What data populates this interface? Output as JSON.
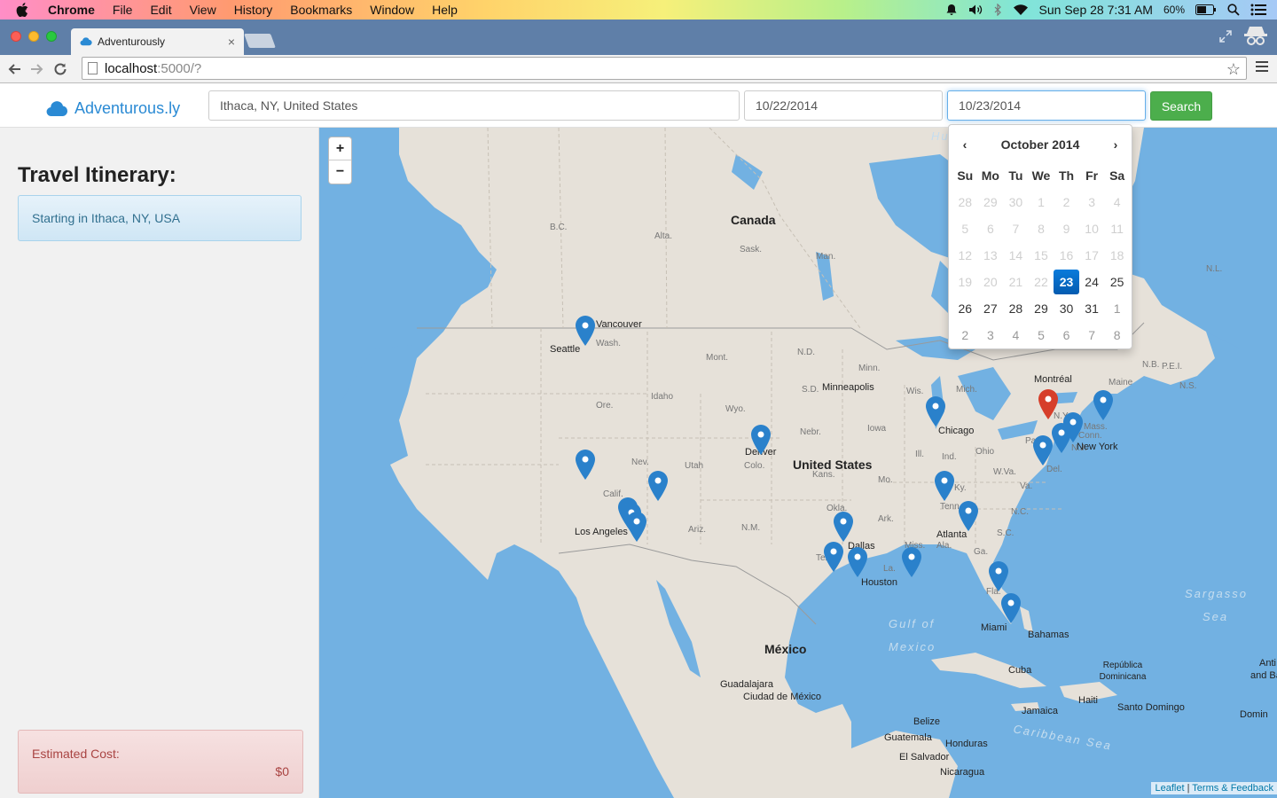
{
  "menubar": {
    "app_name": "Chrome",
    "items": [
      "File",
      "Edit",
      "View",
      "History",
      "Bookmarks",
      "Window",
      "Help"
    ],
    "clock": "Sun Sep 28  7:31 AM",
    "battery": "60%"
  },
  "browser": {
    "tab_title": "Adventurously",
    "url_host": "localhost",
    "url_path": ":5000/?"
  },
  "navbar": {
    "brand": "Adventurous.ly",
    "location_value": "Ithaca, NY, United States",
    "start_date_value": "10/22/2014",
    "end_date_value": "10/23/2014",
    "search_label": "Search"
  },
  "sidebar": {
    "title": "Travel Itinerary:",
    "items": [
      {
        "label": "Starting in Ithaca, NY, USA"
      }
    ],
    "cost_label": "Estimated Cost:",
    "cost_value": "$0"
  },
  "map": {
    "zoom_in": "+",
    "zoom_out": "−",
    "attribution_leaflet": "Leaflet",
    "attribution_sep": " | ",
    "attribution_terms": "Terms & Feedback",
    "labels": {
      "canada": "Canada",
      "united_states": "United States",
      "mexico": "México",
      "bc": "B.C.",
      "alta": "Alta.",
      "sask": "Sask.",
      "man": "Man.",
      "nl": "N.L.",
      "nb": "N.B.",
      "pei": "P.E.I.",
      "ns": "N.S.",
      "maine": "Maine",
      "hu": "Hu",
      "wash": "Wash.",
      "ore": "Ore.",
      "idaho": "Idaho",
      "mont": "Mont.",
      "wyo": "Wyo.",
      "nd": "N.D.",
      "sd": "S.D.",
      "nebr": "Nebr.",
      "minn": "Minn.",
      "iowa": "Iowa",
      "wis": "Wis.",
      "mich": "Mich.",
      "ill": "Ill.",
      "ind": "Ind.",
      "ohio": "Ohio",
      "wva": "W.Va.",
      "va": "Va.",
      "ky": "Ky.",
      "tenn": "Tenn.",
      "nc": "N.C.",
      "sc": "S.C.",
      "ga": "Ga.",
      "ala": "Ala.",
      "miss": "Miss.",
      "la": "La.",
      "ark": "Ark.",
      "mo": "Mo.",
      "kans": "Kans.",
      "okla": "Okla.",
      "tex": "Tex.",
      "nm": "N.M.",
      "ariz": "Ariz.",
      "utah": "Utah",
      "nev": "Nev.",
      "calif": "Calif.",
      "colo": "Colo.",
      "fla": "Fla.",
      "mass": "Mass.",
      "conn": "Conn.",
      "nj": "N.J.",
      "pa": "Pa.",
      "del": "Del.",
      "ny": "N.Y.",
      "seattle": "Seattle",
      "vancouver": "Vancouver",
      "los_angeles": "Los Angeles",
      "denver": "Denver",
      "minneapolis": "Minneapolis",
      "chicago": "Chicago",
      "dallas": "Dallas",
      "houston": "Houston",
      "atlanta": "Atlanta",
      "miami": "Miami",
      "new_york": "New York",
      "montreal": "Montréal",
      "bahamas": "Bahamas",
      "cuba": "Cuba",
      "haiti": "Haiti",
      "jamaica": "Jamaica",
      "republica_dominicana": "República Dominicana",
      "santo_domingo": "Santo Domingo",
      "guadalajara": "Guadalajara",
      "ciudad_de_mexico": "Ciudad de México",
      "belize": "Belize",
      "guatemala": "Guatemala",
      "honduras": "Honduras",
      "el_salvador": "El Salvador",
      "nicaragua": "Nicaragua",
      "gulf_of_mexico_1": "Gulf of",
      "gulf_of_mexico_2": "Mexico",
      "sargasso_1": "Sargasso",
      "sargasso_2": "Sea",
      "caribbean": "Caribbean Sea",
      "antigua": "Anti",
      "and_ba": "and Ba",
      "domin": "Domin"
    }
  },
  "datepicker": {
    "month_title": "October 2014",
    "prev": "‹",
    "next": "›",
    "weekdays": [
      "Su",
      "Mo",
      "Tu",
      "We",
      "Th",
      "Fr",
      "Sa"
    ],
    "weeks": [
      [
        "28",
        "29",
        "30",
        "1",
        "2",
        "3",
        "4"
      ],
      [
        "5",
        "6",
        "7",
        "8",
        "9",
        "10",
        "11"
      ],
      [
        "12",
        "13",
        "14",
        "15",
        "16",
        "17",
        "18"
      ],
      [
        "19",
        "20",
        "21",
        "22",
        "23",
        "24",
        "25"
      ],
      [
        "26",
        "27",
        "28",
        "29",
        "30",
        "31",
        "1"
      ],
      [
        "2",
        "3",
        "4",
        "5",
        "6",
        "7",
        "8"
      ]
    ],
    "selected_day": "23"
  },
  "colors": {
    "accent": "#2a8ad4",
    "search_button": "#4cae4c",
    "marker_blue": "#2a81cb",
    "marker_red": "#d63e2a",
    "water": "#72b1e2",
    "land": "#e6e1d9"
  }
}
